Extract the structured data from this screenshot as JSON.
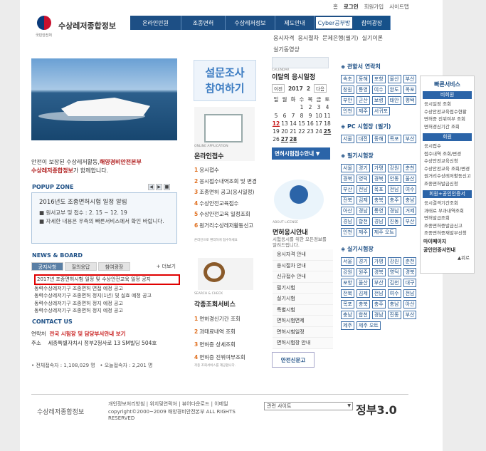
{
  "header": {
    "logo_text": "수상레저종합정보",
    "logo_sub": "국민안전처",
    "util_links": [
      "홈",
      "로그인",
      "회원가입",
      "사이트맵"
    ]
  },
  "gnb": [
    "온라인민원",
    "조종면허",
    "수상레저정보",
    "제도안내",
    "Cyber공부방",
    "참여광장"
  ],
  "sub_menu": [
    "응시자격",
    "응시절차",
    "문제은행(필기)",
    "실기이론",
    "실기동영상"
  ],
  "slogan": {
    "line1": "안전이 보장된 수상레저활동,",
    "line1_b": "해양경비안전본부",
    "line2": "수상레저종합정보",
    "line2_tail": "가 함께합니다."
  },
  "popup": {
    "title": "POPUP ZONE",
    "nav": [
      "◀",
      "▶",
      "■"
    ],
    "notice_title": "2016년도 조종면허시험 일정 알림",
    "line1": "■ 원서교부 및 접수 : 2. 15 ~ 12. 19",
    "line2": "■ 자세한 내용은 우측의 빠른서비스에서 확인 바랍니다."
  },
  "news": {
    "title": "NEWS & BOARD",
    "tabs": [
      "공지사항",
      "질의응답",
      "참여광장"
    ],
    "more": "+ 더보기",
    "items": [
      "2017년 조종면허시험 일정 및 수상안전교육 일정 공지",
      "동력수상레저기구 조종면허 면접 예정 공고",
      "동력수상레저기구 조종면허 정지(1년) 및 실효 예정 공고",
      "동력수상레저기구 조종면허 정지 예정 공고",
      "동력수상레저기구 조종면허 정지 예정 공고"
    ]
  },
  "contact": {
    "title": "CONTACT US",
    "phone_label": "연락처",
    "phone_value": "전국 시험장 및 담당부서안내 보기",
    "addr_label": "주소",
    "addr_value": "세종특별자치시 정부2청사로 13 SM빌딩 504호"
  },
  "counter": {
    "total_label": "전체접속자 :",
    "total_value": "1,108,029 명",
    "today_label": "오늘접속자 :",
    "today_value": "2,201 명"
  },
  "survey": {
    "line1": "설문조사",
    "line2": "참여하기"
  },
  "online": {
    "caption": "ONLINE APPLICATION",
    "title": "온라인접수",
    "items": [
      "응시접수",
      "응시접수내역조회 및 변경",
      "조종면허 공고(응시일정)",
      "수상안전교육접수",
      "수상안전교육 일정조회",
      "원거리수상레저활동신고"
    ],
    "note": "온라인으로 편리하게 접수하세요"
  },
  "search": {
    "caption": "SEARCH & CHECK",
    "title": "각종조회서비스",
    "items": [
      "면허경신기간 조회",
      "과태료내역 조회",
      "면허증 상세조회",
      "면허증 진위여부조회"
    ],
    "note": "각종 조회서비스를 제공합니다."
  },
  "calendar": {
    "caption": "CALENDAR",
    "title": "이달의 응시일정",
    "prev": "이전",
    "year": "2017",
    "month": "2",
    "next": "다음",
    "days": [
      "일",
      "월",
      "화",
      "수",
      "목",
      "금",
      "토"
    ],
    "rows": [
      [
        "",
        "",
        "",
        "1",
        "2",
        "3",
        "4"
      ],
      [
        "5",
        "6",
        "7",
        "8",
        "9",
        "10",
        "11"
      ],
      [
        "12",
        "13",
        "14",
        "15",
        "16",
        "17",
        "18"
      ],
      [
        "19",
        "20",
        "21",
        "22",
        "23",
        "24",
        "25"
      ],
      [
        "26",
        "27",
        "28",
        "",
        "",
        "",
        ""
      ]
    ],
    "button": "면허시험접수안내 ▼"
  },
  "license": {
    "caption": "ABOUT LICENSE",
    "title": "면허응시안내",
    "desc": "시험응시를 위한 모든정보를 알려드립니다.",
    "items": [
      "응시자격 안내",
      "응시절차 안내",
      "신규접수 안내",
      "필기시험",
      "실기시험",
      "특별시험",
      "면허시험면제",
      "면허시험일정",
      "면허시험장 안내"
    ],
    "safe_banner": "안전신문고"
  },
  "regions": {
    "title1": "관할서 연락처",
    "chips1": [
      "속초",
      "동해",
      "포항",
      "울산",
      "부산",
      "창원",
      "통영",
      "여수",
      "완도",
      "목포",
      "부안",
      "군산",
      "보령",
      "태안",
      "평택",
      "인천",
      "제주",
      "서귀포"
    ],
    "title2": "PC 시험장 (필기)",
    "chips2": [
      "서울",
      "대전",
      "동해",
      "목포",
      "부산"
    ],
    "title3": "필기시험장",
    "chips3": [
      "서울",
      "경기",
      "가평",
      "강원",
      "춘천",
      "경북",
      "영덕",
      "경북",
      "안동",
      "울산",
      "부산",
      "전남",
      "목포",
      "전남",
      "여수",
      "전북",
      "김제",
      "충북",
      "충주",
      "충남",
      "아산",
      "경남",
      "통영",
      "경남",
      "거제",
      "경남",
      "합천",
      "경남",
      "진동",
      "부산",
      "인천",
      "제주",
      "제주 오트"
    ],
    "title4": "실기시험장",
    "chips4": [
      "서울",
      "경기",
      "가평",
      "강원",
      "춘천",
      "강원",
      "원주",
      "경북",
      "영덕",
      "경북",
      "포항",
      "울산",
      "부산",
      "김천",
      "대구",
      "전북",
      "김제",
      "전남",
      "여수",
      "전남",
      "목포",
      "충북",
      "충주",
      "충남",
      "아산",
      "충남",
      "합천",
      "경남",
      "진동",
      "부산",
      "제주",
      "제주 오트"
    ]
  },
  "quick": {
    "title": "빠른서비스",
    "sec1": "비회원",
    "items1": [
      "응시일정 조회",
      "수상안전교육접수현황",
      "면허증 진위여부 조회",
      "면허경신기간 조회"
    ],
    "sec2": "회원",
    "items2": [
      "응시접수",
      "접수내역 조회/변경",
      "수상안전교육신청",
      "수상안전교육 조회/변경",
      "원거리수상레저활동신고",
      "조종면허발급신청"
    ],
    "sec3": "회원+공인인증서",
    "items3": [
      "응시결격기간조회",
      "과태료 부과내역조회",
      "면허발급조회",
      "조종면허증발급신고",
      "조종면허증재발부신청"
    ],
    "mypage": "마이페이지",
    "cert": "공인인증서안내",
    "top": "▲위로"
  },
  "footer": {
    "logo": "수상레저종합정보",
    "links": "개인정보처리방침 | 위치및연락처 | 뷰어다운로드 | 이메일",
    "copy": "copyright©2000~2009 해양경비안전본부 ALL RIGHTS RESERVED",
    "select": "관련 사이트",
    "gov": "정부3.0"
  }
}
